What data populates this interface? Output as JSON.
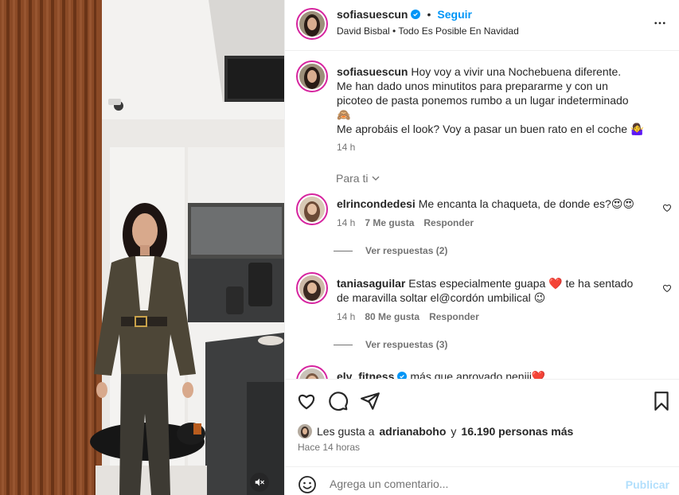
{
  "post": {
    "username": "sofiasuescun",
    "verified": true,
    "separator": "•",
    "follow_label": "Seguir",
    "audio": "David Bisbal • Todo Es Posible En Navidad",
    "more_icon": "more-horizontal-icon"
  },
  "caption": {
    "username": "sofiasuescun",
    "line1": "Hoy voy a vivir una Nochebuena diferente.",
    "line2": "Me han dado unos minutitos para prepararme y con un",
    "line3": "picoteo de pasta ponemos rumbo a un lugar indeterminado",
    "line4": "🙈",
    "line5": "Me aprobáis el look? Voy a pasar un buen rato en el coche 🤷‍♀️",
    "time": "14 h"
  },
  "filter": {
    "label": "Para ti"
  },
  "comments": [
    {
      "username": "elrincondedesi",
      "text": "Me encanta la chaqueta, de donde es?😍😍",
      "time": "14 h",
      "likes": "7 Me gusta",
      "reply_label": "Responder",
      "view_replies": "Ver respuestas (2)"
    },
    {
      "username": "taniasaguilar",
      "text": "Estas especialmente guapa ❤️ te ha sentado",
      "text2": "de maravilla soltar el@cordón umbilical 😉",
      "time": "14 h",
      "likes": "80 Me gusta",
      "reply_label": "Responder",
      "view_replies": "Ver respuestas (3)"
    },
    {
      "username": "ely_fitness",
      "verified": true,
      "text": "más que aprovado nenjii❤️"
    }
  ],
  "likes": {
    "prefix": "Les gusta a",
    "user": "adrianaboho",
    "middle": "y",
    "count": "16.190 personas más"
  },
  "posted": "Hace 14 horas",
  "composer": {
    "placeholder": "Agrega un comentario...",
    "publish_label": "Publicar"
  },
  "colors": {
    "accent": "#0095f6",
    "text": "#262626",
    "secondary": "#737373",
    "like_red": "#ed4956",
    "publish_disabled": "#b2dffc"
  }
}
